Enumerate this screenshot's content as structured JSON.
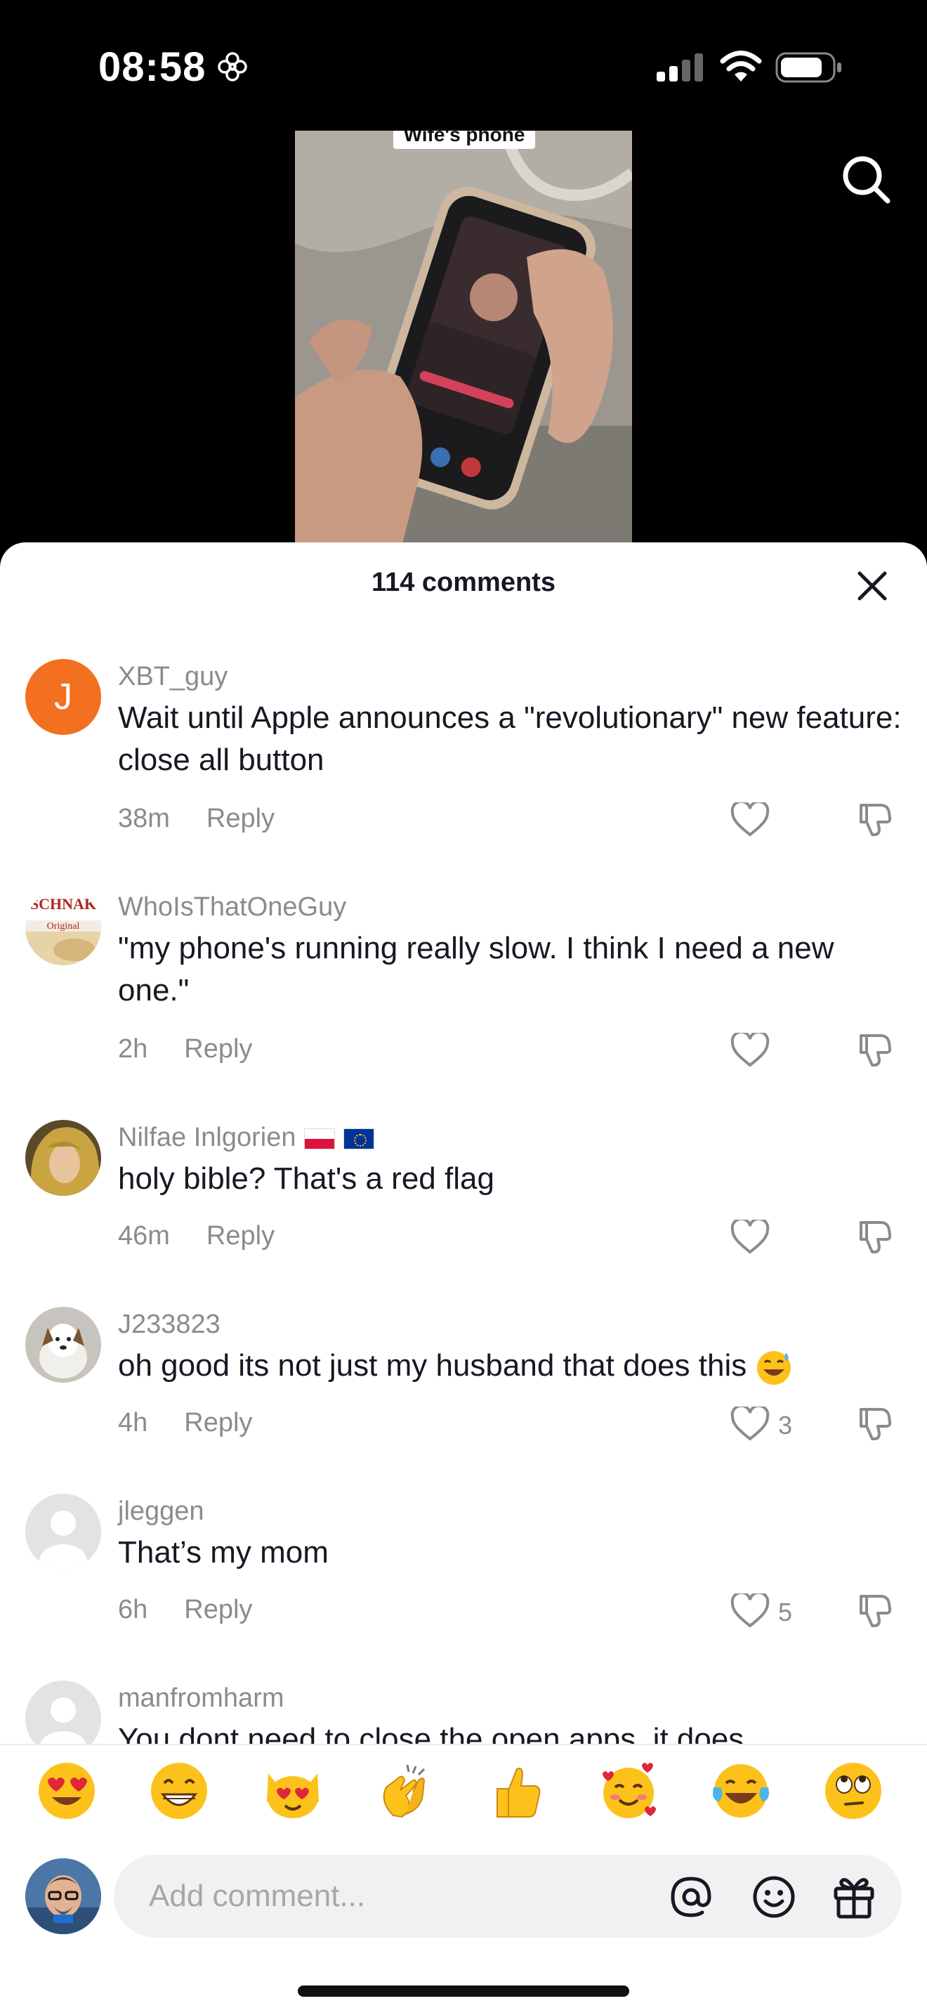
{
  "status_bar": {
    "time": "08:58",
    "focus_icon": "flower-focus-icon",
    "signal_icon": "cellular-signal-icon",
    "wifi_icon": "wifi-icon",
    "battery_icon": "battery-icon"
  },
  "video": {
    "caption": "Wife's phone",
    "search_icon": "search-icon"
  },
  "sheet": {
    "title": "114 comments",
    "close_icon": "close-icon"
  },
  "comments": [
    {
      "username": "XBT_guy",
      "avatar_letter": "J",
      "avatar_color": "#f2701f",
      "text": "Wait until Apple announces a \"revolutionary\" new feature: close all button",
      "time": "38m",
      "reply_label": "Reply",
      "likes": ""
    },
    {
      "username": "WhoIsThatOneGuy",
      "text": "\"my phone's running really slow. I think I need a new one.\"",
      "time": "2h",
      "reply_label": "Reply",
      "likes": ""
    },
    {
      "username": "Nilfae Inlgorien",
      "flags": [
        "flag-poland-icon",
        "flag-eu-icon"
      ],
      "text": "holy bible? That's a red flag",
      "time": "46m",
      "reply_label": "Reply",
      "likes": ""
    },
    {
      "username": "J233823",
      "text": "oh good its not just my husband that does this",
      "emoji": "grinning-sweat-emoji",
      "time": "4h",
      "reply_label": "Reply",
      "likes": "3"
    },
    {
      "username": "jleggen",
      "text": "That’s my mom",
      "time": "6h",
      "reply_label": "Reply",
      "likes": "5"
    },
    {
      "username": "manfromharm",
      "text": "You dont need to close the open apps, it does",
      "time": "",
      "reply_label": "",
      "likes": ""
    }
  ],
  "quick_emojis": [
    "heart-eyes-emoji",
    "beaming-face-emoji",
    "heart-eyes-cat-emoji",
    "clapping-hands-emoji",
    "thumbs-up-emoji",
    "smiling-hearts-emoji",
    "tears-of-joy-emoji",
    "eye-roll-emoji"
  ],
  "composer": {
    "placeholder": "Add comment...",
    "at_icon": "at-mention-icon",
    "emoji_icon": "emoji-picker-icon",
    "gift_icon": "gift-icon"
  },
  "colors": {
    "accent_avatar": "#f2701f",
    "text_primary": "#161823",
    "text_secondary": "#8a8b91"
  }
}
